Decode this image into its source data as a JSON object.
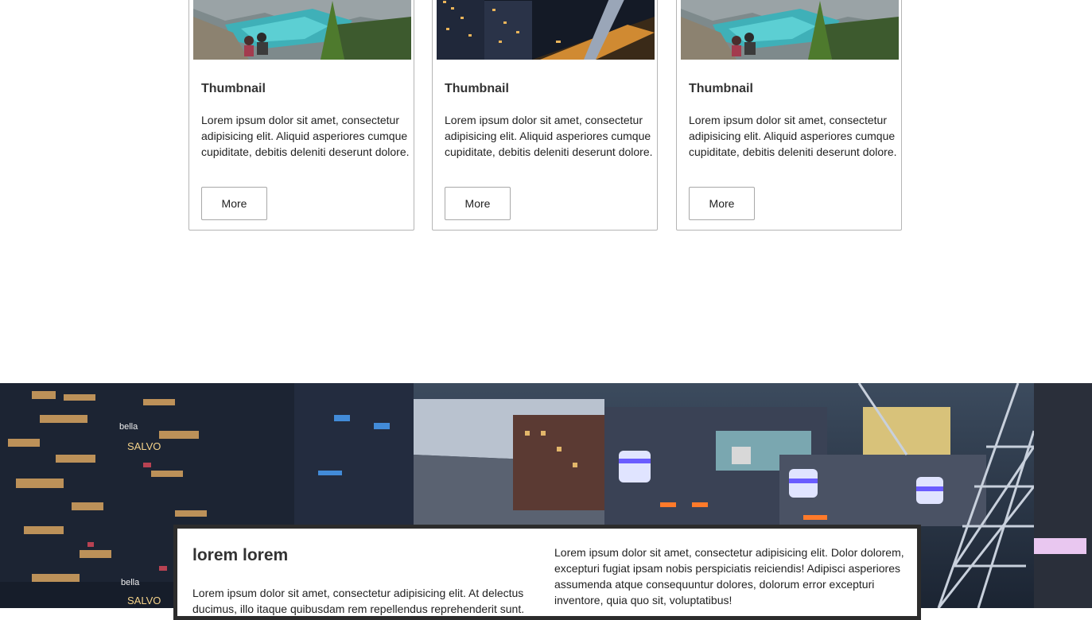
{
  "cards": [
    {
      "image": "lake-mountain-photo",
      "title": "Thumbnail",
      "text": "Lorem ipsum dolor sit amet, consectetur adipisicing elit. Aliquid asperiores cumque cupiditate, debitis deleniti deserunt dolore.",
      "button": "More"
    },
    {
      "image": "city-night-photo",
      "title": "Thumbnail",
      "text": "Lorem ipsum dolor sit amet, consectetur adipisicing elit. Aliquid asperiores cumque cupiditate, debitis deleniti deserunt dolore.",
      "button": "More"
    },
    {
      "image": "lake-mountain-photo",
      "title": "Thumbnail",
      "text": "Lorem ipsum dolor sit amet, consectetur adipisicing elit. Aliquid asperiores cumque cupiditate, debitis deleniti deserunt dolore.",
      "button": "More"
    }
  ],
  "banner": {
    "image": "city-night-banner-photo",
    "sign_text_1": "bella",
    "sign_text_2": "SALVO",
    "sign_text_3": "bella",
    "sign_text_4": "SALVO",
    "title": "lorem lorem",
    "left_text": "Lorem ipsum dolor sit amet, consectetur adipisicing elit. At delectus ducimus, illo itaque quibusdam rem repellendus reprehenderit sunt.",
    "right_text": "Lorem ipsum dolor sit amet, consectetur adipisicing elit. Dolor dolorem, excepturi fugiat ipsam nobis perspiciatis reiciendis! Adipisci asperiores assumenda atque consequuntur dolores, dolorum error excepturi inventore, quia quo sit, voluptatibus!"
  },
  "colors": {
    "card_border": "#b5b5b5",
    "text": "#333333",
    "info_border": "#2c2c2c"
  }
}
